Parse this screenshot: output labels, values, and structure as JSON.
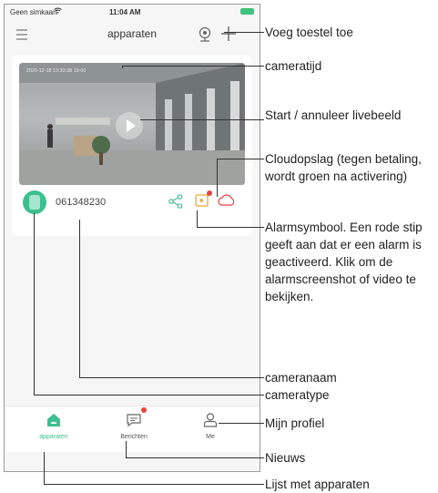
{
  "status_bar": {
    "carrier": "Geen simkaart",
    "time": "11:04 AM"
  },
  "nav": {
    "title": "apparaten"
  },
  "device": {
    "timestamp": "2020-12-18 13:33:38 10:00",
    "name": "061348230"
  },
  "tabs": [
    {
      "label": "apparaten",
      "active": true
    },
    {
      "label": "Berichten",
      "active": false
    },
    {
      "label": "Me",
      "active": false
    }
  ],
  "callouts": {
    "add_device": "Voeg toestel toe",
    "camera_time": "cameratijd",
    "start_live": "Start / annuleer livebeeld",
    "cloud": "Cloudopslag (tegen betaling, wordt groen na activering)",
    "alarm": "Alarmsymbool. Een rode stip geeft aan dat er een alarm is geactiveerd. Klik om de alarmscreenshot of video te bekijken.",
    "camera_name": "cameranaam",
    "camera_type": "cameratype",
    "my_profile": "Mijn profiel",
    "news": "Nieuws",
    "device_list": "Lijst met apparaten"
  },
  "colors": {
    "accent": "#3dbf8e",
    "alert": "#e8423f"
  }
}
